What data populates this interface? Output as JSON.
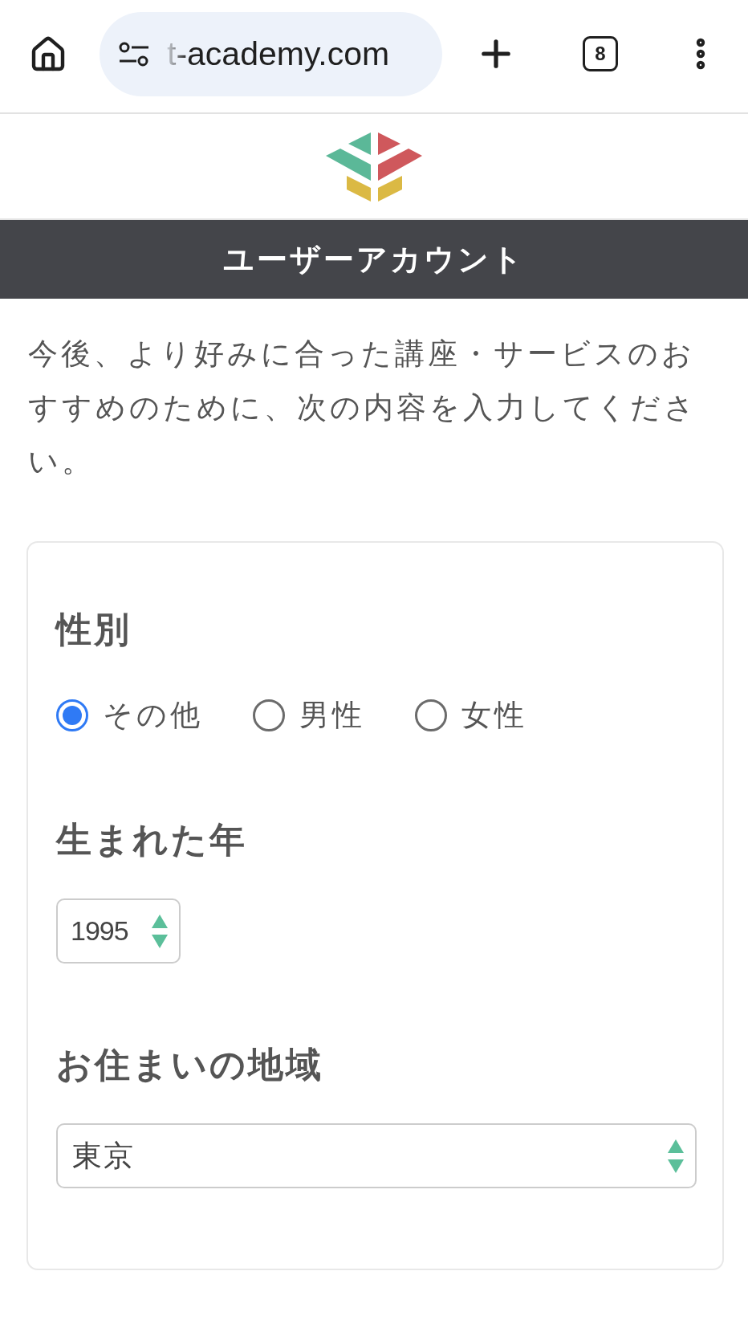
{
  "browser": {
    "url": "t-academy.com",
    "tab_count": "8"
  },
  "header": {
    "title": "ユーザーアカウント"
  },
  "intro": "今後、より好みに合った講座・サービスのおすすめのために、次の内容を入力してください。",
  "form": {
    "fields": [
      {
        "kind": "radio",
        "label": "性別",
        "options": [
          {
            "label": "その他",
            "selected": true
          },
          {
            "label": "男性",
            "selected": false
          },
          {
            "label": "女性",
            "selected": false
          }
        ]
      },
      {
        "kind": "compact_select",
        "label": "生まれた年",
        "value": "1995"
      },
      {
        "kind": "select",
        "label": "お住まいの地域",
        "value": "東京"
      }
    ]
  }
}
